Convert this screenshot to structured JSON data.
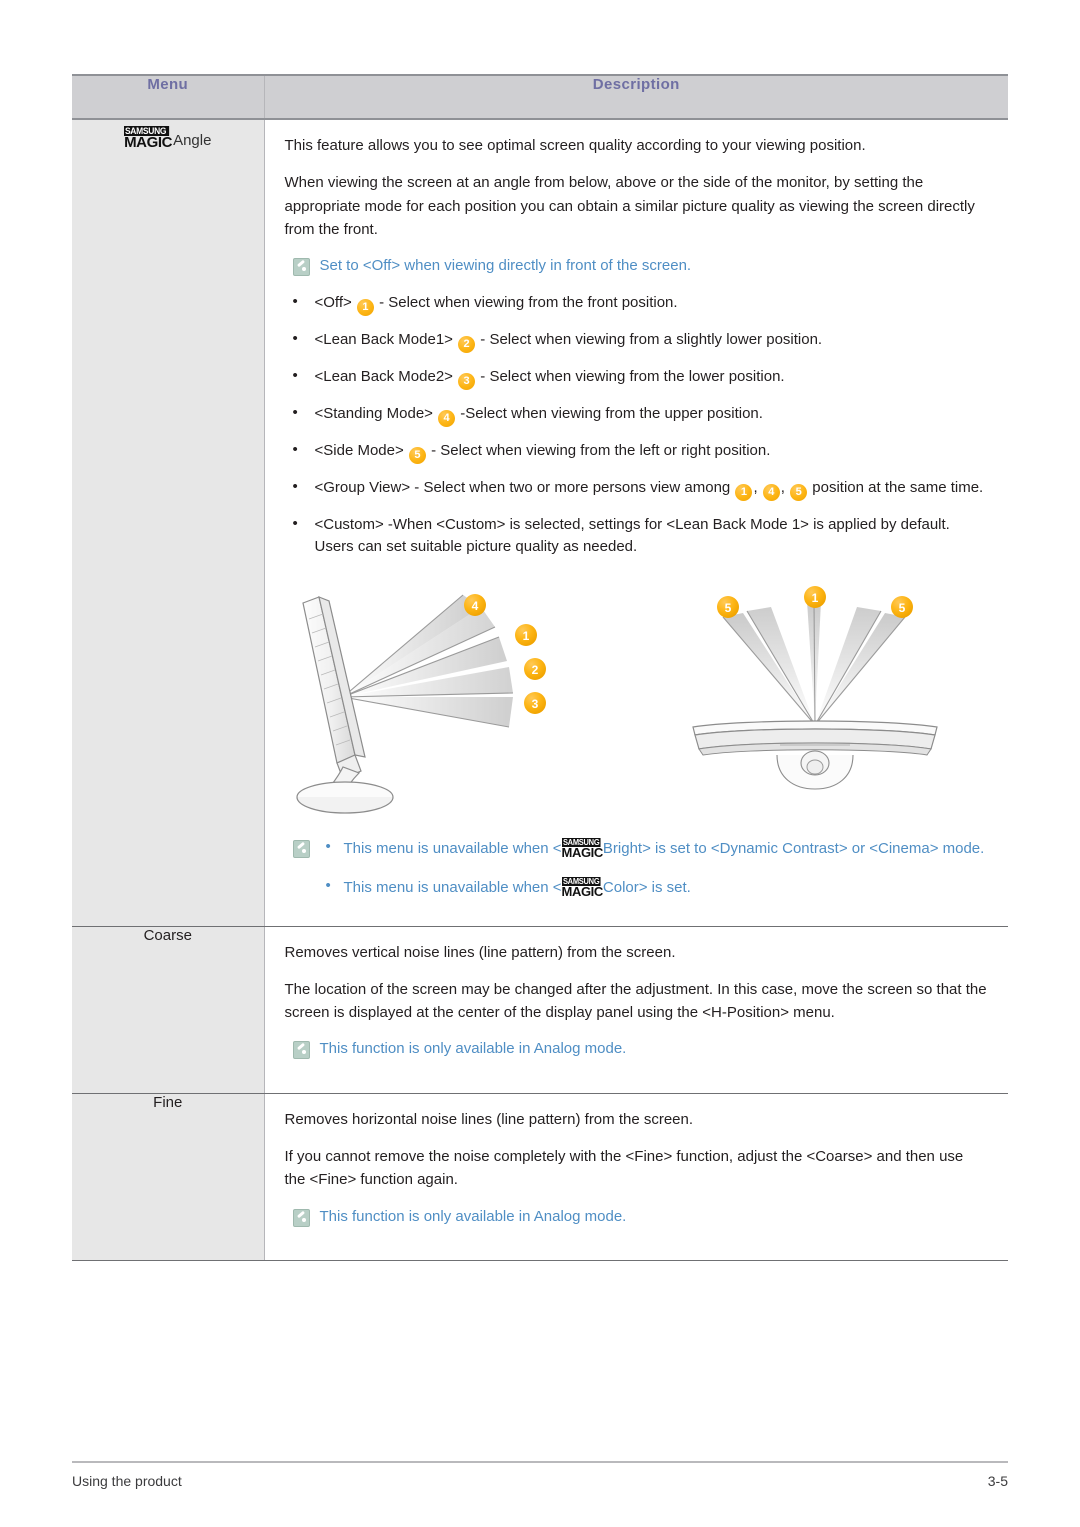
{
  "table": {
    "headers": {
      "menu": "Menu",
      "description": "Description"
    },
    "rows": [
      {
        "menu": {
          "logo_top": "SAMSUNG",
          "logo_bottom": "MAGIC",
          "suffix": "Angle"
        },
        "paragraphs": [
          "This feature allows you to see optimal screen quality according to your viewing position.",
          "When viewing the screen at an angle from below, above or the side of the monitor, by setting the appropriate mode for each position you can obtain a similar picture quality as viewing the screen directly from the front."
        ],
        "note": "Set to <Off> when viewing directly in front of the screen.",
        "bullets": [
          {
            "pre": "<Off> ",
            "badge": "1",
            "post": " - Select when viewing from the front position."
          },
          {
            "pre": "<Lean Back Mode1> ",
            "badge": "2",
            "post": " - Select when viewing from a slightly lower position."
          },
          {
            "pre": "<Lean Back Mode2> ",
            "badge": "3",
            "post": " - Select when viewing from the lower position."
          },
          {
            "pre": "<Standing Mode> ",
            "badge": "4",
            "post": " -Select when viewing from the upper position."
          },
          {
            "pre": "<Side Mode> ",
            "badge": "5",
            "post": " - Select when viewing from the left or right position."
          },
          {
            "pre": "<Group View>  - Select when two or more persons view among ",
            "badges": [
              "1",
              "4",
              "5"
            ],
            "post": " position at the same time."
          },
          {
            "pre": " <Custom> -When <Custom> is selected, settings for <Lean Back Mode 1> is applied by default. Users can set suitable picture quality as needed.",
            "post": ""
          }
        ],
        "diagram": {
          "side_view_labels": [
            "4",
            "1",
            "2",
            "3"
          ],
          "top_view_labels": [
            "5",
            "1",
            "5"
          ]
        },
        "notes_block": [
          {
            "pre": "This menu is unavailable when <",
            "logo_top": "SAMSUNG",
            "logo_bottom": "MAGIC",
            "post": "Bright> is set to <Dynamic Contrast> or <Cinema> mode."
          },
          {
            "pre": "This menu is unavailable when <",
            "logo_top": "SAMSUNG",
            "logo_bottom": "MAGIC",
            "post": "Color> is set."
          }
        ]
      },
      {
        "menu_text": "Coarse",
        "paragraphs": [
          "Removes vertical noise lines (line pattern) from the screen.",
          "The location of the screen may be changed after the adjustment. In this case, move the screen so that the screen is displayed at the center of the display panel using the <H-Position> menu."
        ],
        "note": "This function is only available in Analog mode."
      },
      {
        "menu_text": "Fine",
        "paragraphs": [
          "Removes horizontal noise lines (line pattern) from the screen.",
          "If you cannot remove the noise completely with the <Fine> function, adjust the <Coarse> and then use the <Fine> function again."
        ],
        "note": "This function is only available in Analog mode."
      }
    ]
  },
  "footer": {
    "left": "Using the product",
    "right": "3-5"
  },
  "colors": {
    "header_bg": "#cfcfd2",
    "header_text": "#6f6fa3",
    "menu_col_bg": "#e7e7e7",
    "note_text": "#4f8ec4",
    "badge": "#fdb515",
    "note_icon": "#b8cfc6",
    "body_text": "#231f20"
  }
}
